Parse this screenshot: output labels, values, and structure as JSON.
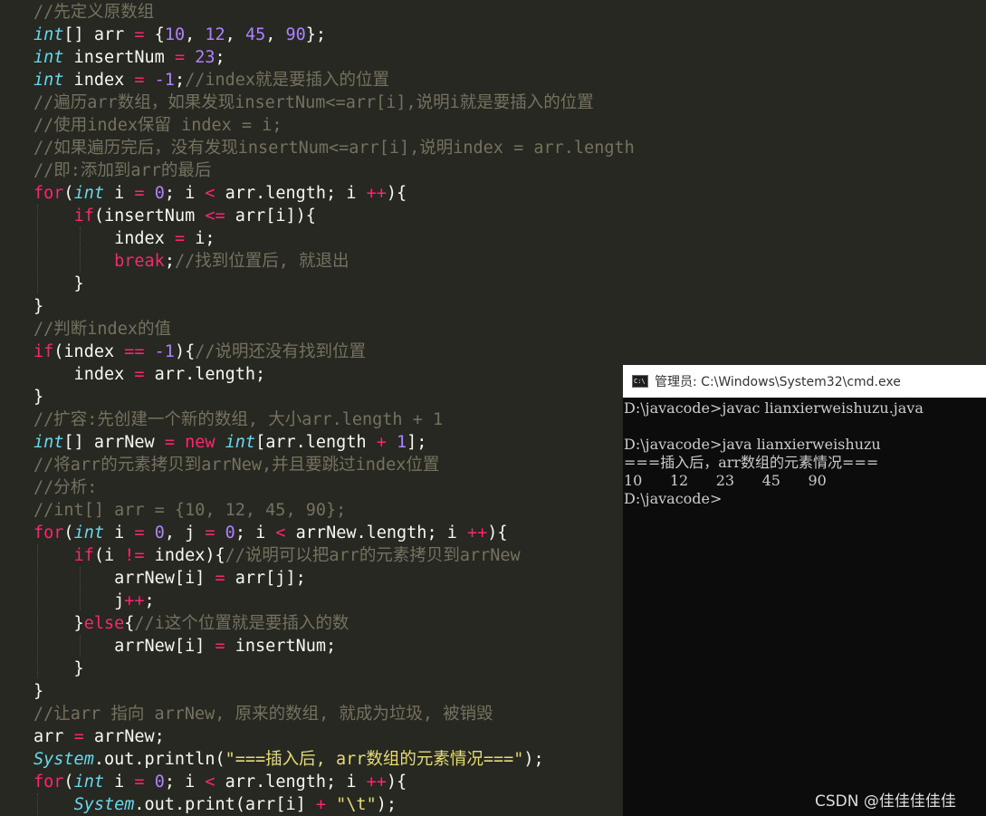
{
  "editor": {
    "theme": {
      "bg": "#272822",
      "fg": "#f8f8f2",
      "comment": "#75715e",
      "keyword": "#f92672",
      "type": "#66d9ef",
      "number": "#ae81ff",
      "string": "#e6db74"
    },
    "lines": [
      [
        [
          "c",
          "//先定义原数组"
        ]
      ],
      [
        [
          "t",
          "int"
        ],
        [
          "p",
          "[] arr "
        ],
        [
          "o",
          "="
        ],
        [
          "p",
          " {"
        ],
        [
          "n",
          "10"
        ],
        [
          "p",
          ", "
        ],
        [
          "n",
          "12"
        ],
        [
          "p",
          ", "
        ],
        [
          "n",
          "45"
        ],
        [
          "p",
          ", "
        ],
        [
          "n",
          "90"
        ],
        [
          "p",
          "};"
        ]
      ],
      [
        [
          "t",
          "int"
        ],
        [
          "p",
          " insertNum "
        ],
        [
          "o",
          "="
        ],
        [
          "p",
          " "
        ],
        [
          "n",
          "23"
        ],
        [
          "p",
          ";"
        ]
      ],
      [
        [
          "t",
          "int"
        ],
        [
          "p",
          " index "
        ],
        [
          "o",
          "="
        ],
        [
          "p",
          " "
        ],
        [
          "n",
          "-1"
        ],
        [
          "p",
          ";"
        ],
        [
          "c",
          "//index就是要插入的位置"
        ]
      ],
      [
        [
          "c",
          "//遍历arr数组，如果发现insertNum<=arr[i],说明i就是要插入的位置"
        ]
      ],
      [
        [
          "c",
          "//使用index保留 index = i;"
        ]
      ],
      [
        [
          "c",
          "//如果遍历完后，没有发现insertNum<=arr[i],说明index = arr.length"
        ]
      ],
      [
        [
          "c",
          "//即:添加到arr的最后"
        ]
      ],
      [
        [
          "k",
          "for"
        ],
        [
          "p",
          "("
        ],
        [
          "t",
          "int"
        ],
        [
          "p",
          " i "
        ],
        [
          "o",
          "="
        ],
        [
          "p",
          " "
        ],
        [
          "n",
          "0"
        ],
        [
          "p",
          "; i "
        ],
        [
          "o",
          "<"
        ],
        [
          "p",
          " arr.length; i "
        ],
        [
          "o",
          "++"
        ],
        [
          "p",
          "){"
        ]
      ],
      [
        [
          "p",
          "    "
        ],
        [
          "k",
          "if"
        ],
        [
          "p",
          "(insertNum "
        ],
        [
          "o",
          "<="
        ],
        [
          "p",
          " arr[i]){"
        ]
      ],
      [
        [
          "p",
          "        index "
        ],
        [
          "o",
          "="
        ],
        [
          "p",
          " i;"
        ]
      ],
      [
        [
          "p",
          "        "
        ],
        [
          "k",
          "break"
        ],
        [
          "p",
          ";"
        ],
        [
          "c",
          "//找到位置后, 就退出"
        ]
      ],
      [
        [
          "p",
          "    }"
        ]
      ],
      [
        [
          "p",
          "}"
        ]
      ],
      [
        [
          "c",
          "//判断index的值"
        ]
      ],
      [
        [
          "k",
          "if"
        ],
        [
          "p",
          "(index "
        ],
        [
          "o",
          "=="
        ],
        [
          "p",
          " "
        ],
        [
          "n",
          "-1"
        ],
        [
          "p",
          "){"
        ],
        [
          "c",
          "//说明还没有找到位置"
        ]
      ],
      [
        [
          "p",
          "    index "
        ],
        [
          "o",
          "="
        ],
        [
          "p",
          " arr.length;"
        ]
      ],
      [
        [
          "p",
          "}"
        ]
      ],
      [
        [
          "c",
          "//扩容:先创建一个新的数组, 大小arr.length + 1"
        ]
      ],
      [
        [
          "t",
          "int"
        ],
        [
          "p",
          "[] arrNew "
        ],
        [
          "o",
          "="
        ],
        [
          "p",
          " "
        ],
        [
          "k",
          "new"
        ],
        [
          "p",
          " "
        ],
        [
          "t",
          "int"
        ],
        [
          "p",
          "[arr.length "
        ],
        [
          "o",
          "+"
        ],
        [
          "p",
          " "
        ],
        [
          "n",
          "1"
        ],
        [
          "p",
          "];"
        ]
      ],
      [
        [
          "c",
          "//将arr的元素拷贝到arrNew,并且要跳过index位置"
        ]
      ],
      [
        [
          "c",
          "//分析:"
        ]
      ],
      [
        [
          "c",
          "//int[] arr = {10, 12, 45, 90};"
        ]
      ],
      [
        [
          "k",
          "for"
        ],
        [
          "p",
          "("
        ],
        [
          "t",
          "int"
        ],
        [
          "p",
          " i "
        ],
        [
          "o",
          "="
        ],
        [
          "p",
          " "
        ],
        [
          "n",
          "0"
        ],
        [
          "p",
          ", j "
        ],
        [
          "o",
          "="
        ],
        [
          "p",
          " "
        ],
        [
          "n",
          "0"
        ],
        [
          "p",
          "; i "
        ],
        [
          "o",
          "<"
        ],
        [
          "p",
          " arrNew.length; i "
        ],
        [
          "o",
          "++"
        ],
        [
          "p",
          "){"
        ]
      ],
      [
        [
          "p",
          "    "
        ],
        [
          "k",
          "if"
        ],
        [
          "p",
          "(i "
        ],
        [
          "o",
          "!="
        ],
        [
          "p",
          " index){"
        ],
        [
          "c",
          "//说明可以把arr的元素拷贝到arrNew"
        ]
      ],
      [
        [
          "p",
          "        arrNew[i] "
        ],
        [
          "o",
          "="
        ],
        [
          "p",
          " arr[j];"
        ]
      ],
      [
        [
          "p",
          "        j"
        ],
        [
          "o",
          "++"
        ],
        [
          "p",
          ";"
        ]
      ],
      [
        [
          "p",
          "    }"
        ],
        [
          "k",
          "else"
        ],
        [
          "p",
          "{"
        ],
        [
          "c",
          "//i这个位置就是要插入的数"
        ]
      ],
      [
        [
          "p",
          "        arrNew[i] "
        ],
        [
          "o",
          "="
        ],
        [
          "p",
          " insertNum;"
        ]
      ],
      [
        [
          "p",
          "    }"
        ]
      ],
      [
        [
          "p",
          "}"
        ]
      ],
      [
        [
          "c",
          "//让arr 指向 arrNew, 原来的数组, 就成为垃圾, 被销毁"
        ]
      ],
      [
        [
          "p",
          "arr "
        ],
        [
          "o",
          "="
        ],
        [
          "p",
          " arrNew;"
        ]
      ],
      [
        [
          "s",
          "System"
        ],
        [
          "p",
          "."
        ],
        [
          "p",
          "out.println("
        ],
        [
          "str",
          "\"===插入后, arr数组的元素情况===\""
        ],
        [
          "p",
          ");"
        ]
      ],
      [
        [
          "k",
          "for"
        ],
        [
          "p",
          "("
        ],
        [
          "t",
          "int"
        ],
        [
          "p",
          " i "
        ],
        [
          "o",
          "="
        ],
        [
          "p",
          " "
        ],
        [
          "n",
          "0"
        ],
        [
          "p",
          "; i "
        ],
        [
          "o",
          "<"
        ],
        [
          "p",
          " arr.length; i "
        ],
        [
          "o",
          "++"
        ],
        [
          "p",
          "){"
        ]
      ],
      [
        [
          "p",
          "    "
        ],
        [
          "s",
          "System"
        ],
        [
          "p",
          ".out.print(arr[i] "
        ],
        [
          "o",
          "+"
        ],
        [
          "p",
          " "
        ],
        [
          "str",
          "\"\\t\""
        ],
        [
          "p",
          ");"
        ]
      ]
    ]
  },
  "cmd": {
    "title": "管理员: C:\\Windows\\System32\\cmd.exe",
    "icon": "cmd-prompt-icon",
    "lines": [
      "D:\\javacode>javac lianxierweishuzu.java",
      "",
      "D:\\javacode>java lianxierweishuzu",
      "===插入后，arr数组的元素情况===",
      "10      12      23      45      90",
      "D:\\javacode>"
    ]
  },
  "watermark": "CSDN @佳佳佳佳佳"
}
